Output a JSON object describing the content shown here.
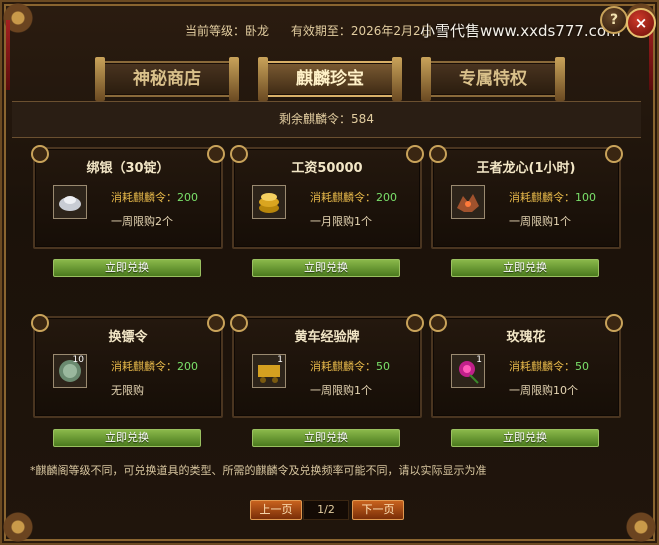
{
  "header": {
    "level_label": "当前等级：卧龙",
    "expiry_label": "有效期至：2026年2月2日",
    "watermark": "小雪代售www.xxds777.com"
  },
  "controls": {
    "help": "?",
    "close": "×"
  },
  "tabs": [
    {
      "label": "神秘商店",
      "active": false
    },
    {
      "label": "麒麟珍宝",
      "active": true
    },
    {
      "label": "专属特权",
      "active": false
    }
  ],
  "remaining": "剩余麒麟令：584",
  "items": [
    {
      "title": "绑银（30锭）",
      "icon": "silver-ingot-icon",
      "qty": "",
      "cost_label": "消耗麒麟令：",
      "cost": "200",
      "limit": "一周限购2个"
    },
    {
      "title": "工资50000",
      "icon": "gold-coins-icon",
      "qty": "",
      "cost_label": "消耗麒麟令：",
      "cost": "200",
      "limit": "一月限购1个"
    },
    {
      "title": "王者龙心(1小时)",
      "icon": "dragon-heart-icon",
      "qty": "",
      "cost_label": "消耗麒麟令：",
      "cost": "100",
      "limit": "一周限购1个"
    },
    {
      "title": "换镖令",
      "icon": "escort-token-icon",
      "qty": "10",
      "cost_label": "消耗麒麟令：",
      "cost": "200",
      "limit": "无限购"
    },
    {
      "title": "黄车经验牌",
      "icon": "cart-exp-card-icon",
      "qty": "1",
      "cost_label": "消耗麒麟令：",
      "cost": "50",
      "limit": "一周限购1个"
    },
    {
      "title": "玫瑰花",
      "icon": "rose-icon",
      "qty": "1",
      "cost_label": "消耗麒麟令：",
      "cost": "50",
      "limit": "一周限购10个"
    }
  ],
  "exchange_label": "立即兑换",
  "footnote": "*麒麟阁等级不同，可兑换道具的类型、所需的麒麟令及兑换频率可能不同，请以实际显示为准",
  "pager": {
    "prev": "上一页",
    "page": "1/2",
    "next": "下一页"
  }
}
